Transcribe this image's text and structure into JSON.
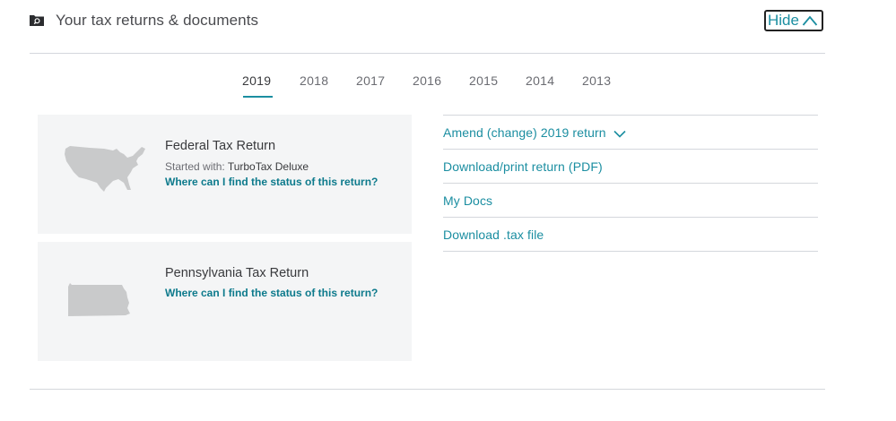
{
  "header": {
    "title": "Your tax returns & documents",
    "hide_label": "Hide"
  },
  "years": [
    "2019",
    "2018",
    "2017",
    "2016",
    "2015",
    "2014",
    "2013"
  ],
  "selected_year": "2019",
  "returns": {
    "federal": {
      "title": "Federal Tax Return",
      "started_prefix": "Started with:",
      "product": "TurboTax Deluxe",
      "status_link": "Where can I find the status of this return?"
    },
    "state": {
      "title": "Pennsylvania Tax Return",
      "status_link": "Where can I find the status of this return?"
    }
  },
  "actions": {
    "amend": "Amend (change) 2019 return",
    "download_pdf": "Download/print return (PDF)",
    "my_docs": "My Docs",
    "download_tax": "Download .tax file"
  },
  "colors": {
    "accent": "#1b8ea1",
    "link_dark": "#0d7a8c",
    "card_bg": "#f4f5f6",
    "map_fill": "#c9cacb"
  }
}
